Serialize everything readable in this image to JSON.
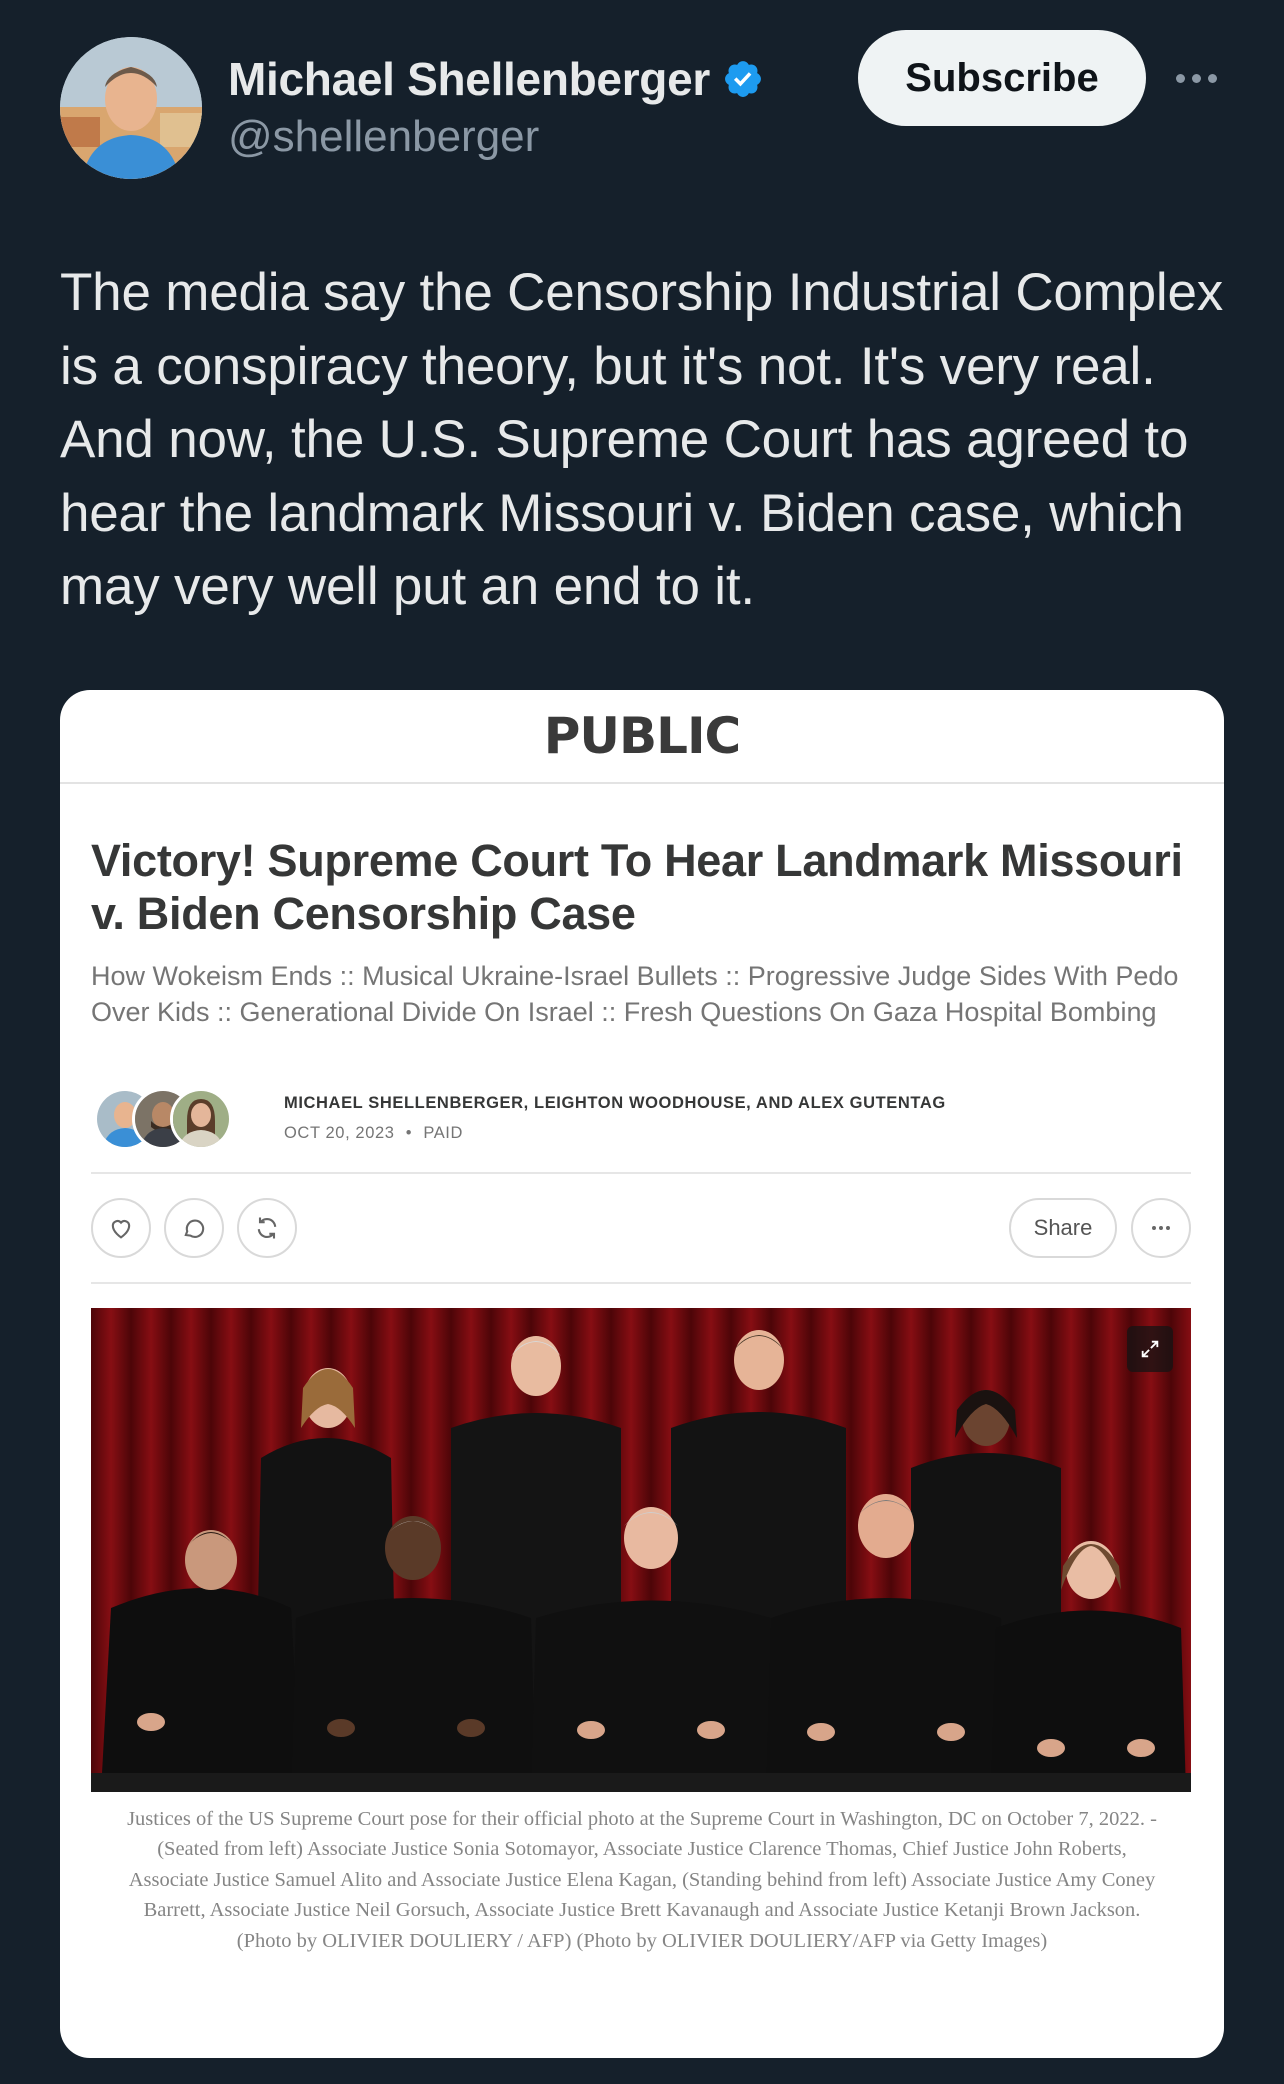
{
  "tweet": {
    "author": {
      "name": "Michael Shellenberger",
      "handle": "@shellenberger",
      "verified": true
    },
    "subscribe_label": "Subscribe",
    "text": "The media say the Censorship Industrial Complex is a conspiracy theory, but it's not. It's very real. And now, the U.S. Supreme Court has agreed to hear the landmark Missouri v. Biden case, which may very well put an end to it."
  },
  "card": {
    "publication": "PUBLIC",
    "title": "Victory! Supreme Court To Hear Landmark Missouri v. Biden Censorship Case",
    "subtitle": "How Wokeism Ends :: Musical Ukraine-Israel Bullets :: Progressive Judge Sides With Pedo Over Kids :: Generational Divide On Israel :: Fresh Questions On Gaza Hospital Bombing",
    "byline": "MICHAEL SHELLENBERGER, LEIGHTON WOODHOUSE, AND ALEX GUTENTAG",
    "date": "OCT 20, 2023",
    "separator": "•",
    "access": "PAID",
    "share_label": "Share",
    "caption": "Justices of the US Supreme Court pose for their official photo at the Supreme Court in Washington, DC on October 7, 2022. - (Seated from left) Associate Justice Sonia Sotomayor, Associate Justice Clarence Thomas, Chief Justice John Roberts, Associate Justice Samuel Alito and Associate Justice Elena Kagan, (Standing behind from left) Associate Justice Amy Coney Barrett, Associate Justice Neil Gorsuch, Associate Justice Brett Kavanaugh and Associate Justice Ketanji Brown Jackson. (Photo by OLIVIER DOULIERY / AFP) (Photo by OLIVIER DOULIERY/AFP via Getty Images)"
  },
  "icons": {
    "verified": "verified-badge-icon",
    "more": "more-horizontal-icon",
    "like": "heart-icon",
    "comment": "comment-icon",
    "restack": "restack-icon",
    "expand": "expand-icon"
  },
  "colors": {
    "background": "#15202b",
    "text_primary": "#e7e9ea",
    "text_secondary": "#8b98a5",
    "verified_blue": "#1d9bf0",
    "card_bg": "#ffffff"
  }
}
